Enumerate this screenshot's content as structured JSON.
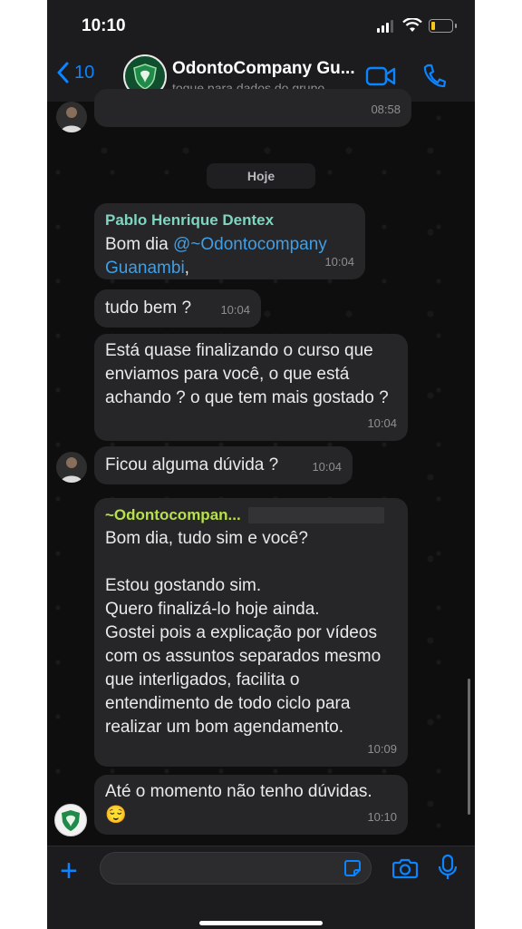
{
  "status_bar": {
    "time": "10:10"
  },
  "header": {
    "back_count": "10",
    "title": "OdontoCompany Gu...",
    "subtitle": "toque para dados do grupo"
  },
  "chat": {
    "prev_message_time": "08:58",
    "date_separator": "Hoje",
    "messages": [
      {
        "sender": "Pablo Henrique Dentex",
        "prefix": "Bom dia ",
        "mention": "@~Odontocompany Guanambi",
        "suffix": ",",
        "time": "10:04"
      },
      {
        "text": "tudo bem ?",
        "time": "10:04"
      },
      {
        "text": "Está quase finalizando o curso que enviamos para você, o que está achando ? o que tem mais gostado ?",
        "time": "10:04"
      },
      {
        "text": "Ficou alguma dúvida ?",
        "time": "10:04"
      },
      {
        "sender": "~Odontocompan...",
        "line1": "Bom dia, tudo sim e você?",
        "line2": "Estou gostando sim.",
        "line3": "Quero finalizá-lo hoje ainda.",
        "line4": "Gostei pois a explicação por vídeos com os assuntos separados mesmo que interligados, facilita o entendimento de todo ciclo para realizar um bom agendamento.",
        "time": "10:09"
      },
      {
        "text": "Até o momento não tenho dúvidas.",
        "emoji": "😌",
        "time": "10:10"
      }
    ]
  },
  "colors": {
    "accent": "#0a84ff",
    "mention": "#3d9fe8",
    "sender_teal": "#7fd6c0",
    "sender_green": "#b7e04a"
  }
}
